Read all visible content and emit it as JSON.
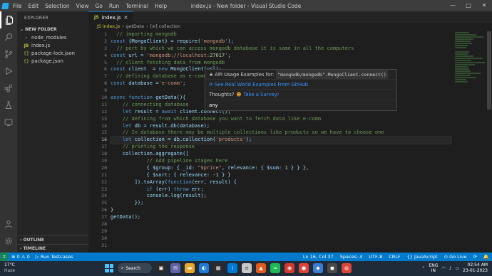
{
  "titlebar": {
    "menu": [
      "File",
      "Edit",
      "Selection",
      "View",
      "Go",
      "Run",
      "Terminal",
      "Help"
    ],
    "window_title": "index.js - New folder - Visual Studio Code",
    "minimize": "—",
    "maximize": "□",
    "close": "✕"
  },
  "explorer": {
    "header": "EXPLORER",
    "section": "NEW FOLDER",
    "items": [
      {
        "icon": "›",
        "name": "node_modules"
      },
      {
        "icon": "JS",
        "name": "index.js"
      },
      {
        "icon": "{}",
        "name": "package-lock.json"
      },
      {
        "icon": "{}",
        "name": "package.json"
      }
    ],
    "outline": "OUTLINE",
    "timeline": "TIMELINE"
  },
  "tab": {
    "icon": "JS",
    "label": "index.js",
    "close": "✕"
  },
  "breadcrumb": [
    "JS index.js",
    "›",
    "getData",
    "›",
    "[⊘] collection"
  ],
  "code": {
    "current_line": 16,
    "lines": [
      "  // importing mongodb",
      "const {MongoClient} = require('mongodb');",
      "  // port by which we can access mongodb database it is same in all the computers",
      "const url = 'mongodb://localhost:27017';",
      "  // client fetching data from mongodb",
      "const client  = new MongoClient(url);",
      "  // defining database as e-comm",
      "const database ='e-comm';",
      "",
      "async function getData(){",
      "    // connecting database",
      "    let result = await client.connect();",
      "    // defining from which database you want to fetch data like e-comm",
      "    let db = result.db(database);",
      "    // In database there may be multiple collections like products so we have to choose one",
      "    let collection = db.collection('products');",
      "    // printing the response",
      "    collection.aggregate([",
      "            // Add pipeline stages here",
      "            { $group: { _id: \"$price\", relevance: { $sum: 1 } } },",
      "            { $sort: { relevance: -1 } }",
      "        ]).toArray(function(err, result) {",
      "            if (err) throw err;",
      "            console.log(result);",
      "        });",
      "}",
      "getData();",
      "",
      "",
      "",
      ""
    ]
  },
  "hover": {
    "title_prefix": "★ API Usage Examples for:",
    "title_code": "\"mongodb/mongodb\".MongoClient.connect()",
    "github_link": "⟳ See Real World Examples From GitHub",
    "thoughts_label": "Thoughts?",
    "survey_link": "Take a Survey!",
    "signature": "any"
  },
  "status": {
    "left": [
      "⊗ 0 ⚠ 0",
      "▷ Run Testcases"
    ],
    "right": [
      "Ln 16, Col 37",
      "Spaces: 4",
      "UTF-8",
      "CRLF",
      "{} JavaScript",
      "⊙ Go Live",
      "⟳",
      "🔔"
    ]
  },
  "taskbar": {
    "weather_temp": "17°C",
    "weather_text": "Haze",
    "search": "Search",
    "lang": "ENG",
    "lang2": "IN",
    "time": "02:54 AM",
    "date": "23-01-2023"
  }
}
